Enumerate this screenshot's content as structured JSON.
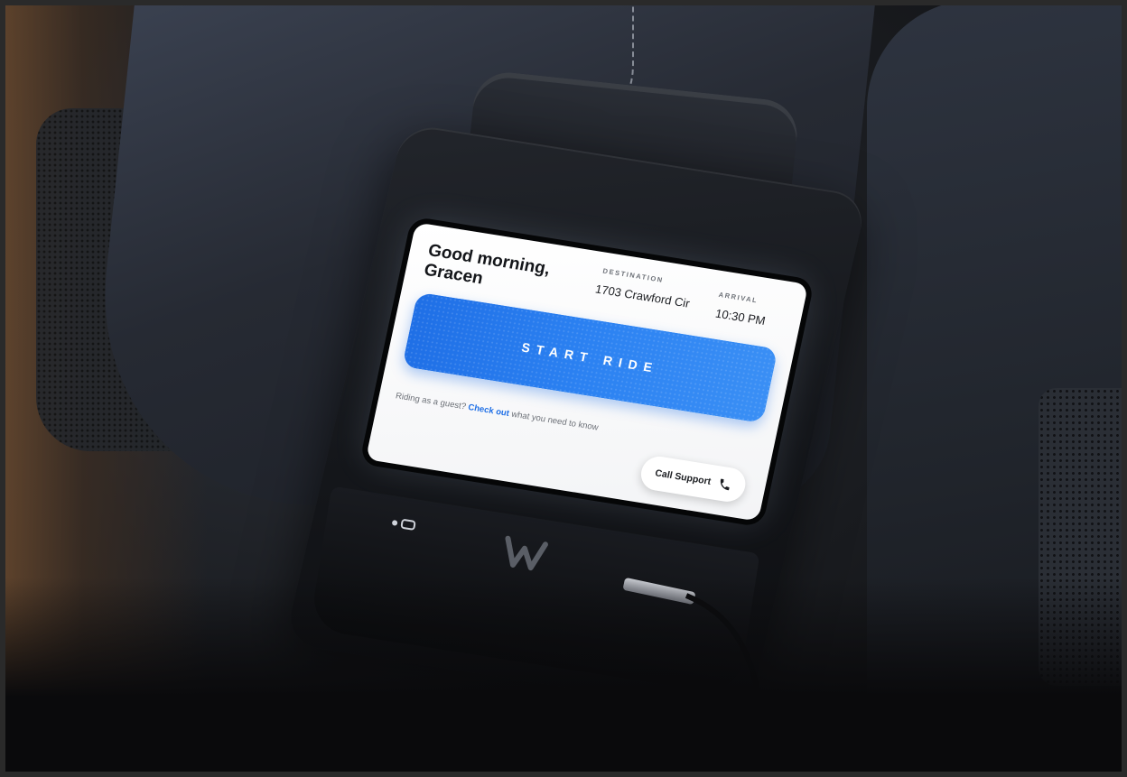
{
  "screen": {
    "greeting": "Good morning, Gracen",
    "destination": {
      "label": "DESTINATION",
      "value": "1703 Crawford Cir"
    },
    "arrival": {
      "label": "ARRIVAL",
      "value": "10:30 PM"
    },
    "start_button": {
      "label": "START RIDE",
      "color": "#1f6fe6"
    },
    "guest_prompt": {
      "prefix": "Riding as a guest?",
      "link": "Check out",
      "suffix": "what you need to know"
    },
    "support_button": {
      "label": "Call Support",
      "icon": "phone-icon"
    }
  },
  "hardware": {
    "brand_logo": "W",
    "port_icon": "usb-c-icon"
  }
}
